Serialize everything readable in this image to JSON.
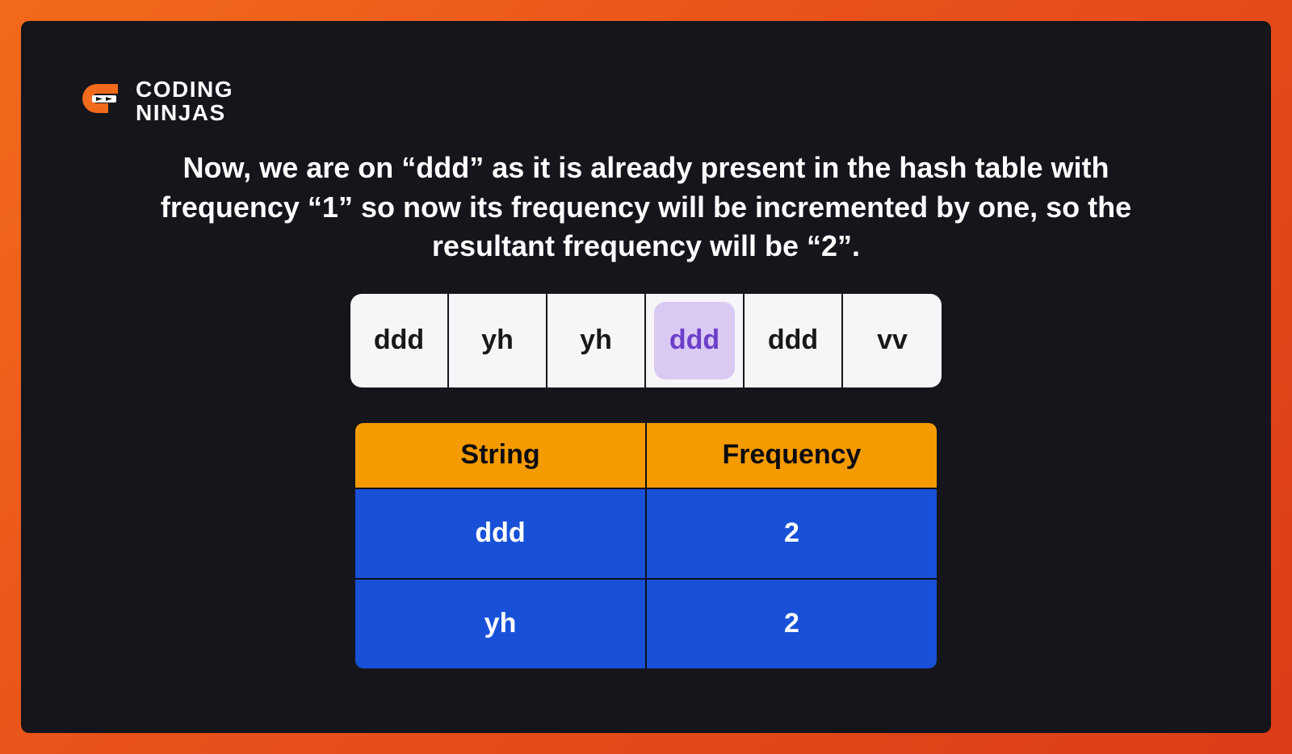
{
  "brand": {
    "line1": "CODING",
    "line2": "NINJAS"
  },
  "description": "Now, we are on “ddd” as it is already present in the hash table with frequency “1” so now its frequency will be incremented by one, so the resultant frequency will be “2”.",
  "array": {
    "cells": [
      "ddd",
      "yh",
      "yh",
      "ddd",
      "ddd",
      "vv"
    ],
    "highlight_index": 3
  },
  "hash_table": {
    "headers": [
      "String",
      "Frequency"
    ],
    "rows": [
      {
        "string": "ddd",
        "frequency": "2"
      },
      {
        "string": "yh",
        "frequency": "2"
      }
    ]
  },
  "colors": {
    "accent_orange": "#f59b00",
    "accent_blue": "#1851d8",
    "highlight_purple": "#d9c9f3",
    "bg_dark": "#15151b"
  }
}
